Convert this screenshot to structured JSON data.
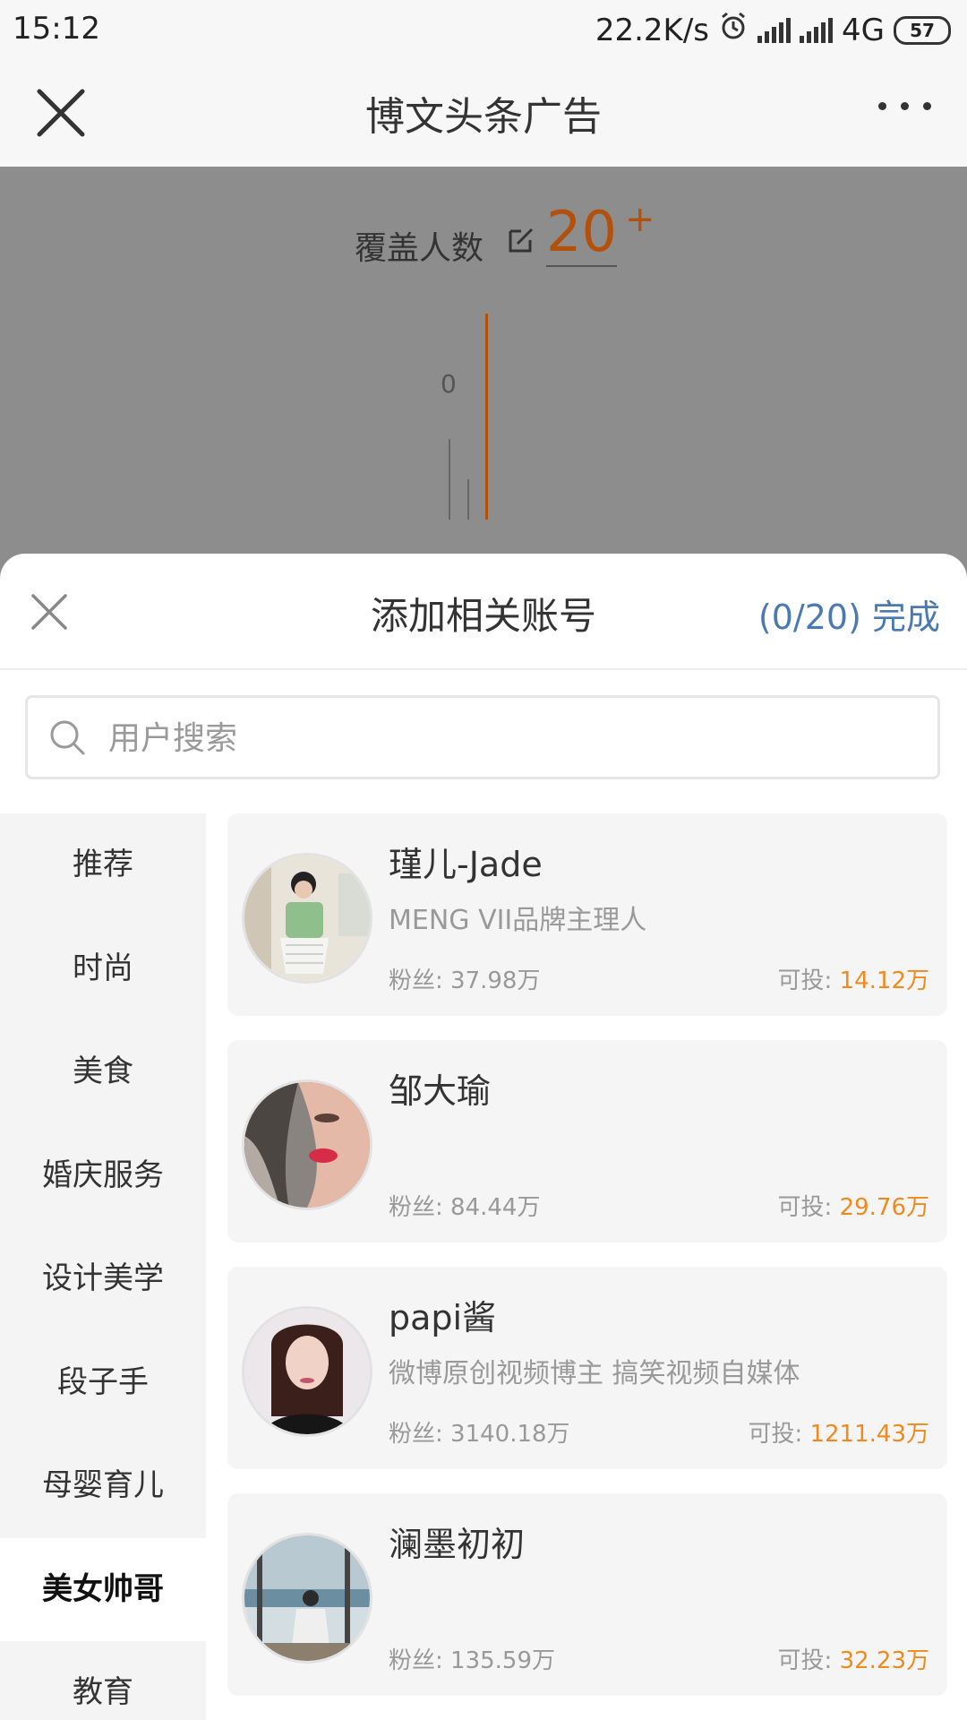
{
  "status": {
    "time": "15:12",
    "net_speed": "22.2K/s",
    "network": "4G",
    "battery": "57"
  },
  "header": {
    "title": "博文头条广告"
  },
  "coverage": {
    "label": "覆盖人数",
    "value": "20",
    "plus": "+",
    "chart_zero": "0"
  },
  "sheet": {
    "title": "添加相关账号",
    "count": "(0/20)",
    "done": "完成",
    "search_placeholder": "用户搜索"
  },
  "categories": [
    {
      "label": "推荐",
      "active": false
    },
    {
      "label": "时尚",
      "active": false
    },
    {
      "label": "美食",
      "active": false
    },
    {
      "label": "婚庆服务",
      "active": false
    },
    {
      "label": "设计美学",
      "active": false
    },
    {
      "label": "段子手",
      "active": false
    },
    {
      "label": "母婴育儿",
      "active": false
    },
    {
      "label": "美女帅哥",
      "active": true
    },
    {
      "label": "教育",
      "active": false
    }
  ],
  "accounts": [
    {
      "name": "瑾儿-Jade",
      "desc": "MENG VII品牌主理人",
      "fans_label": "粉丝:",
      "fans": "37.98万",
      "avail_label": "可投:",
      "avail": "14.12万"
    },
    {
      "name": "邹大瑜",
      "desc": "",
      "fans_label": "粉丝:",
      "fans": "84.44万",
      "avail_label": "可投:",
      "avail": "29.76万"
    },
    {
      "name": "papi酱",
      "desc": "微博原创视频博主 搞笑视频自媒体",
      "fans_label": "粉丝:",
      "fans": "3140.18万",
      "avail_label": "可投:",
      "avail": "1211.43万"
    },
    {
      "name": "澜墨初初",
      "desc": "",
      "fans_label": "粉丝:",
      "fans": "135.59万",
      "avail_label": "可投:",
      "avail": "32.23万"
    }
  ]
}
